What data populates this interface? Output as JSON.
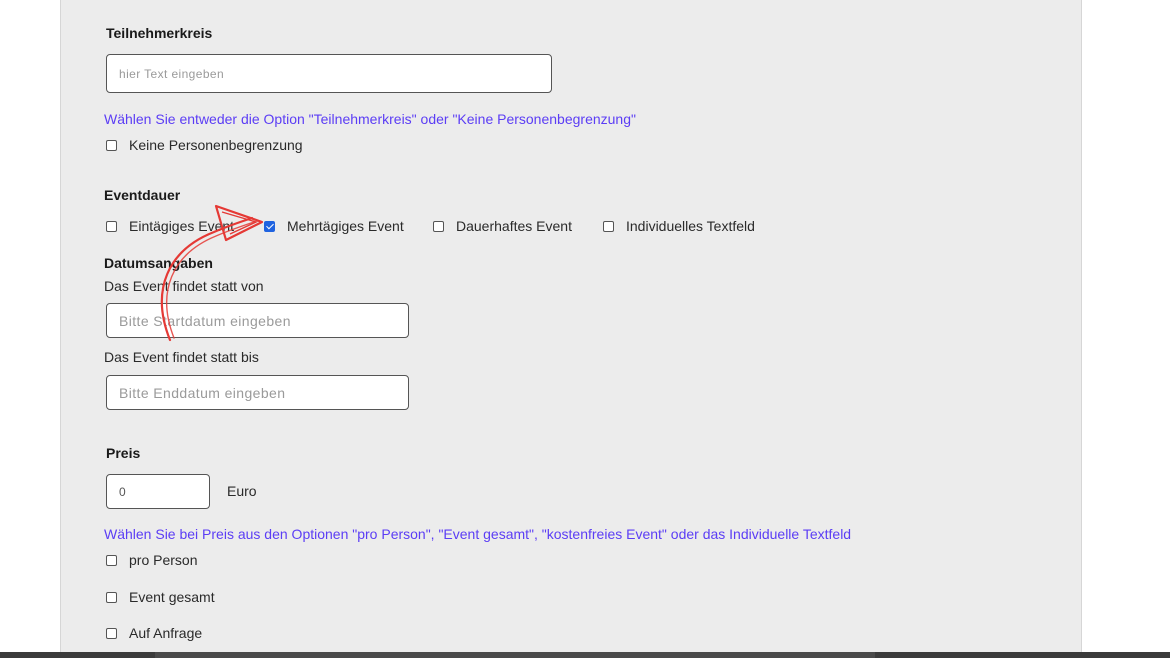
{
  "participants": {
    "heading": "Teilnehmerkreis",
    "input_placeholder": "hier Text eingeben",
    "info": "Wählen Sie entweder die Option \"Teilnehmerkreis\" oder \"Keine Personenbegrenzung\"",
    "no_limit_label": "Keine Personenbegrenzung"
  },
  "duration": {
    "heading": "Eventdauer",
    "options": [
      {
        "label": "Eintägiges Event",
        "checked": false
      },
      {
        "label": "Mehrtägiges Event",
        "checked": true
      },
      {
        "label": "Dauerhaftes Event",
        "checked": false
      },
      {
        "label": "Individuelles Textfeld",
        "checked": false
      }
    ]
  },
  "dates": {
    "heading": "Datumsangaben",
    "from_label": "Das Event findet statt von",
    "from_placeholder": "Bitte Startdatum eingeben",
    "to_label": "Das Event findet statt bis",
    "to_placeholder": "Bitte Enddatum eingeben"
  },
  "price": {
    "heading": "Preis",
    "value": "0",
    "currency": "Euro",
    "info": "Wählen Sie bei Preis aus den Optionen \"pro Person\", \"Event gesamt\", \"kostenfreies Event\" oder das Individuelle Textfeld",
    "options": [
      {
        "label": "pro Person",
        "checked": false
      },
      {
        "label": "Event gesamt",
        "checked": false
      },
      {
        "label": "Auf Anfrage",
        "checked": false
      }
    ]
  },
  "colors": {
    "info_text": "#5b3df5",
    "checkbox_checked": "#1f63e0",
    "annotation_arrow": "#e53935",
    "panel_bg": "#ececec"
  }
}
